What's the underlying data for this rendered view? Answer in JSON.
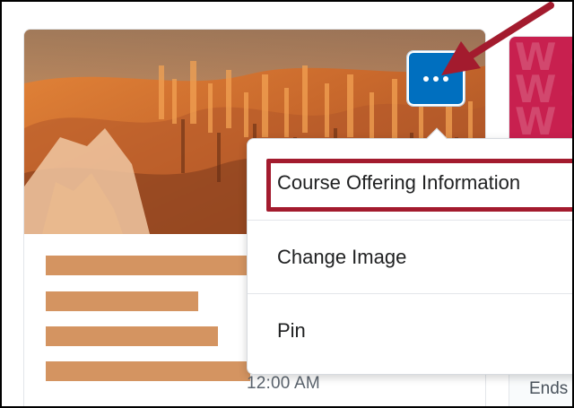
{
  "course_card": {
    "image_alt": "Canyon hoodoo rock formations",
    "date_text": "12:00 AM",
    "bar_color": "#d49461"
  },
  "options_button": {
    "icon": "more-horizontal-icon",
    "color": "#006fbf"
  },
  "context_menu": {
    "items": [
      {
        "label": "Course Offering Information"
      },
      {
        "label": "Change Image"
      },
      {
        "label": "Pin"
      }
    ]
  },
  "neighbor_card": {
    "banner_color": "#c8204f",
    "text": "Ends"
  },
  "annotation": {
    "color": "#a31b2e"
  }
}
